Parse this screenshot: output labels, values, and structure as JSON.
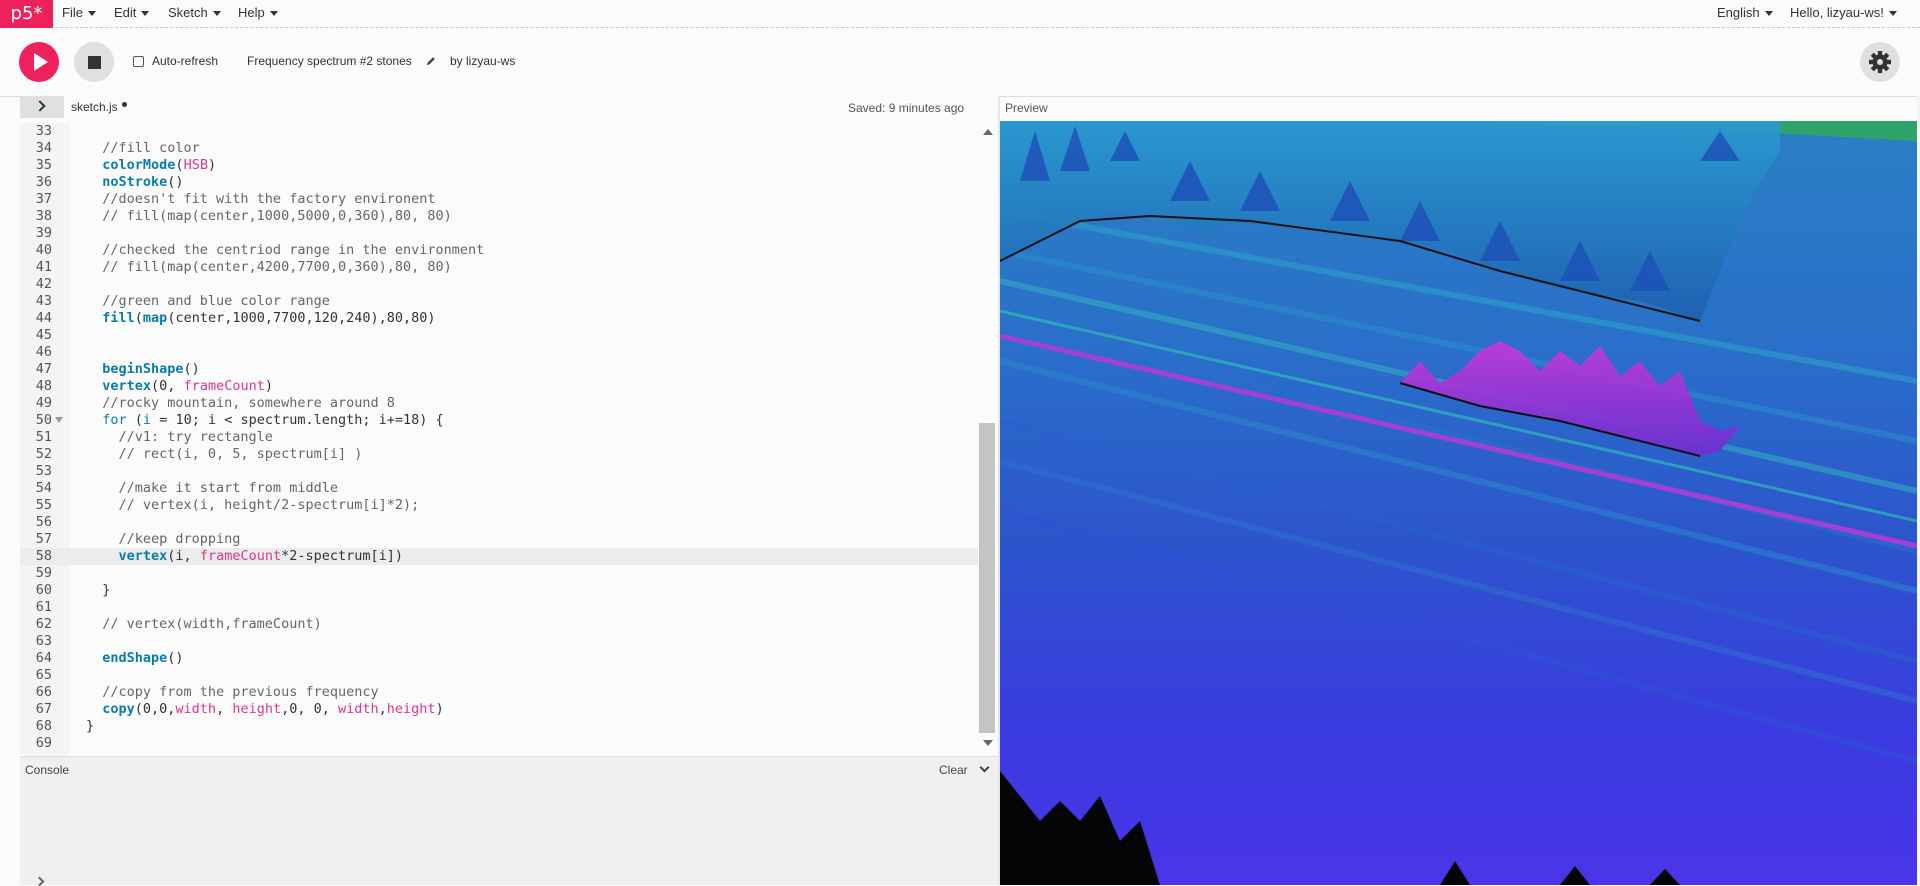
{
  "nav": {
    "logo": "p5*",
    "menus": [
      "File",
      "Edit",
      "Sketch",
      "Help"
    ],
    "language": "English",
    "user_greeting": "Hello, lizyau-ws!"
  },
  "toolbar": {
    "autorefresh_label": "Auto-refresh",
    "autorefresh_checked": false,
    "sketch_name": "Frequency spectrum #2 stones",
    "author": "by lizyau-ws"
  },
  "editor": {
    "file_tab": "sketch.js",
    "saved_status": "Saved: 9 minutes ago",
    "preview_label": "Preview",
    "active_line": "58",
    "lines": [
      {
        "n": "33",
        "t": ""
      },
      {
        "n": "34",
        "t": "  //fill color"
      },
      {
        "n": "35",
        "t": "  colorMode(HSB)"
      },
      {
        "n": "36",
        "t": "  noStroke()"
      },
      {
        "n": "37",
        "t": "  //doesn't fit with the factory environent"
      },
      {
        "n": "38",
        "t": "  // fill(map(center,1000,5000,0,360),80, 80)"
      },
      {
        "n": "39",
        "t": ""
      },
      {
        "n": "40",
        "t": "  //checked the centriod range in the environment"
      },
      {
        "n": "41",
        "t": "  // fill(map(center,4200,7700,0,360),80, 80)"
      },
      {
        "n": "42",
        "t": ""
      },
      {
        "n": "43",
        "t": "  //green and blue color range"
      },
      {
        "n": "44",
        "t": "  fill(map(center,1000,7700,120,240),80,80)"
      },
      {
        "n": "45",
        "t": ""
      },
      {
        "n": "46",
        "t": ""
      },
      {
        "n": "47",
        "t": "  beginShape()"
      },
      {
        "n": "48",
        "t": "  vertex(0, frameCount)"
      },
      {
        "n": "49",
        "t": "  //rocky mountain, somewhere around 8"
      },
      {
        "n": "50",
        "t": "  for (i = 10; i < spectrum.length; i+=18) {"
      },
      {
        "n": "51",
        "t": "    //v1: try rectangle"
      },
      {
        "n": "52",
        "t": "    // rect(i, 0, 5, spectrum[i] )"
      },
      {
        "n": "53",
        "t": ""
      },
      {
        "n": "54",
        "t": "    //make it start from middle"
      },
      {
        "n": "55",
        "t": "    // vertex(i, height/2-spectrum[i]*2);"
      },
      {
        "n": "56",
        "t": ""
      },
      {
        "n": "57",
        "t": "    //keep dropping"
      },
      {
        "n": "58",
        "t": "    vertex(i, frameCount*2-spectrum[i])"
      },
      {
        "n": "59",
        "t": ""
      },
      {
        "n": "60",
        "t": "  }"
      },
      {
        "n": "61",
        "t": ""
      },
      {
        "n": "62",
        "t": "  // vertex(width,frameCount)"
      },
      {
        "n": "63",
        "t": ""
      },
      {
        "n": "64",
        "t": "  endShape()"
      },
      {
        "n": "65",
        "t": ""
      },
      {
        "n": "66",
        "t": "  //copy from the previous frequency"
      },
      {
        "n": "67",
        "t": "  copy(0,0,width, height,0, 0, width,height)"
      },
      {
        "n": "68",
        "t": "}"
      },
      {
        "n": "69",
        "t": ""
      }
    ]
  },
  "console": {
    "label": "Console",
    "clear_label": "Clear"
  },
  "colors": {
    "brand": "#ed225d",
    "keyword": "#0b7ca9",
    "builtin_var": "#dc3787",
    "comment": "#666666"
  }
}
